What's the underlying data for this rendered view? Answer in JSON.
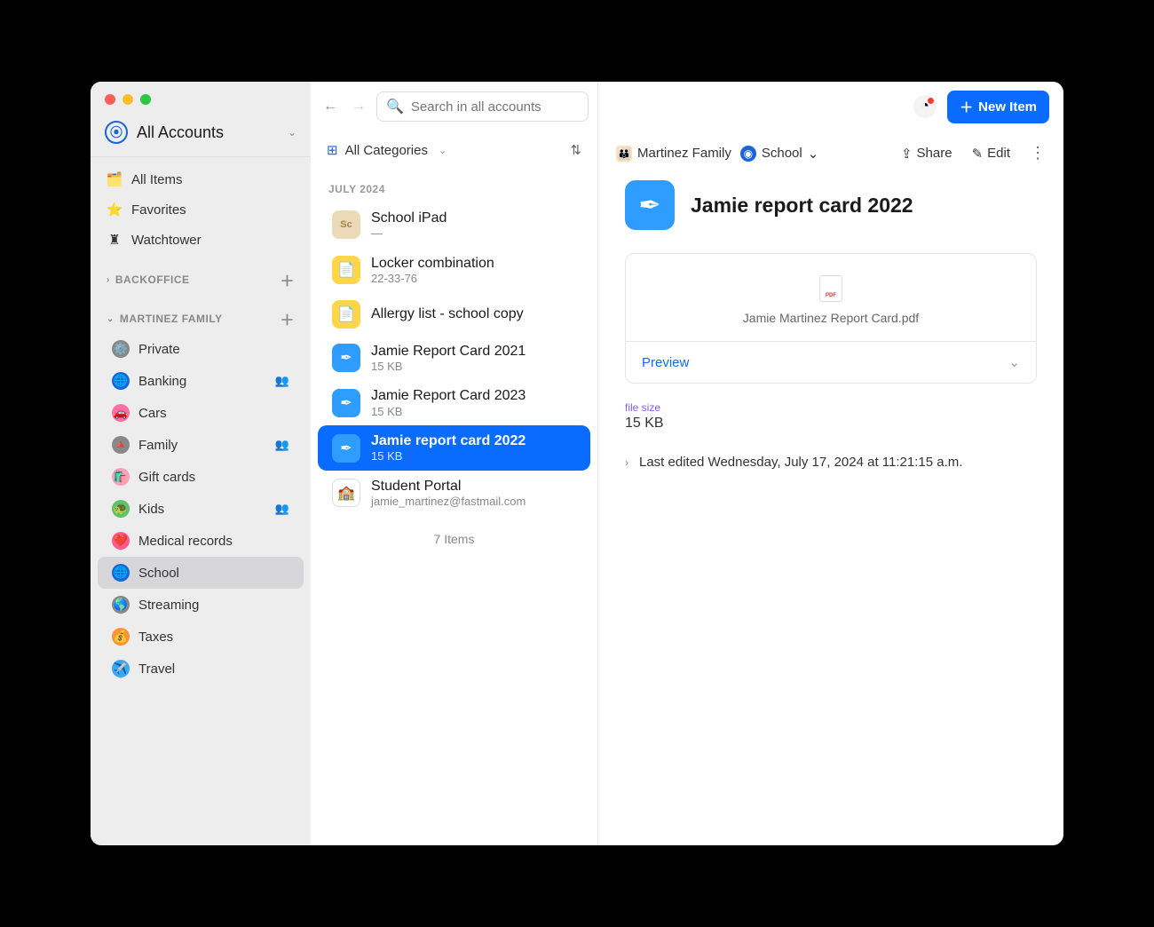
{
  "account": {
    "title": "All Accounts"
  },
  "nav": {
    "all_items": "All Items",
    "favorites": "Favorites",
    "watchtower": "Watchtower"
  },
  "sections": [
    {
      "name": "BACKOFFICE",
      "collapsed": true,
      "vaults": []
    },
    {
      "name": "MARTINEZ FAMILY",
      "collapsed": false,
      "vaults": [
        {
          "label": "Private",
          "icon": "⚙️",
          "shared": false
        },
        {
          "label": "Banking",
          "icon": "🌐",
          "shared": true,
          "iconbg": "#1a66d6"
        },
        {
          "label": "Cars",
          "icon": "🚗",
          "shared": false,
          "iconbg": "#ff6fa5"
        },
        {
          "label": "Family",
          "icon": "🔺",
          "shared": true
        },
        {
          "label": "Gift cards",
          "icon": "🛍️",
          "shared": false,
          "iconbg": "#ff9fbd"
        },
        {
          "label": "Kids",
          "icon": "🐢",
          "shared": true,
          "iconbg": "#5ec26a"
        },
        {
          "label": "Medical records",
          "icon": "❤️",
          "shared": false,
          "iconbg": "#ff5b8e"
        },
        {
          "label": "School",
          "icon": "🌐",
          "shared": false,
          "iconbg": "#1a66d6",
          "selected": true
        },
        {
          "label": "Streaming",
          "icon": "🌎",
          "shared": false
        },
        {
          "label": "Taxes",
          "icon": "💰",
          "shared": false,
          "iconbg": "#ff9238"
        },
        {
          "label": "Travel",
          "icon": "✈️",
          "shared": false,
          "iconbg": "#3aa7ff"
        }
      ]
    }
  ],
  "search": {
    "placeholder": "Search in all accounts"
  },
  "filter": {
    "label": "All Categories"
  },
  "group_label": "JULY 2024",
  "items": [
    {
      "title": "School iPad",
      "sub": "—",
      "thumb": "tan",
      "thumb_text": "Sc"
    },
    {
      "title": "Locker combination",
      "sub": "22-33-76",
      "thumb": "note"
    },
    {
      "title": "Allergy list - school copy",
      "sub": "",
      "thumb": "note"
    },
    {
      "title": "Jamie Report Card 2021",
      "sub": "15 KB",
      "thumb": "doc"
    },
    {
      "title": "Jamie Report Card 2023",
      "sub": "15 KB",
      "thumb": "doc"
    },
    {
      "title": "Jamie report card 2022",
      "sub": "15 KB",
      "thumb": "doc",
      "selected": true
    },
    {
      "title": "Student Portal",
      "sub": "jamie_martinez@fastmail.com",
      "thumb": "portal"
    }
  ],
  "item_count": "7 Items",
  "new_item": "New Item",
  "crumbs": {
    "account": "Martinez Family",
    "vault": "School"
  },
  "actions": {
    "share": "Share",
    "edit": "Edit"
  },
  "detail": {
    "title": "Jamie report card 2022",
    "filename": "Jamie Martinez Report Card.pdf",
    "preview": "Preview",
    "file_size_label": "file size",
    "file_size": "15 KB",
    "edited": "Last edited Wednesday, July 17, 2024 at 11:21:15 a.m."
  }
}
